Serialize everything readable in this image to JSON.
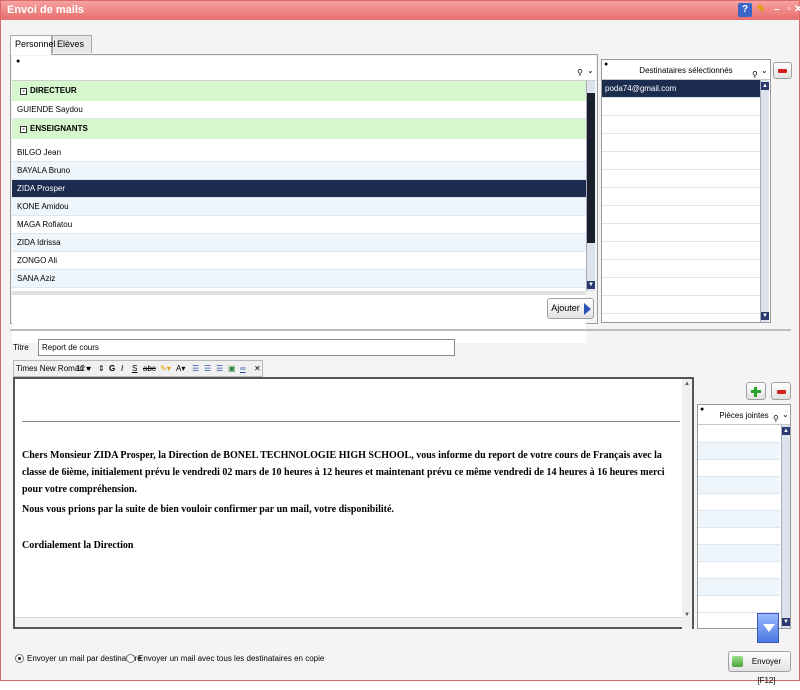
{
  "window": {
    "title": "Envoi de mails"
  },
  "tabs": [
    {
      "label": "Personnel",
      "active": true
    },
    {
      "label": "Elèves",
      "active": false
    }
  ],
  "staff": {
    "rows": [
      {
        "type": "group",
        "label": "DIRECTEUR"
      },
      {
        "type": "item",
        "label": "GUIENDE Saydou"
      },
      {
        "type": "group",
        "label": "ENSEIGNANTS"
      },
      {
        "type": "item",
        "label": "BILGO Jean"
      },
      {
        "type": "item",
        "label": "BAYALA Bruno"
      },
      {
        "type": "item",
        "label": "ZIDA Prosper",
        "selected": true
      },
      {
        "type": "item",
        "label": "KONE Amidou"
      },
      {
        "type": "item",
        "label": "MAGA Rofiatou"
      },
      {
        "type": "item",
        "label": "ZIDA Idrissa"
      },
      {
        "type": "item",
        "label": "ZONGO Ali"
      },
      {
        "type": "item",
        "label": "SANA Aziz"
      }
    ],
    "add_button": "Ajouter"
  },
  "recipients": {
    "header": "Destinataires sélectionnés",
    "items": [
      "poda74@gmail.com"
    ]
  },
  "title_field": {
    "label": "Titre",
    "value": "Report de cours"
  },
  "toolbar": {
    "font": "Times New Roman",
    "size": "12"
  },
  "message": {
    "paragraph1": "Chers Monsieur ZIDA Prosper, la Direction de BONEL TECHNOLOGIE HIGH SCHOOL, vous informe du report de votre cours de Français avec la classe de 6ième, initialement prévu le vendredi 02 mars de 10 heures à 12 heures et maintenant prévu ce même vendredi de 14 heures à 16 heures merci pour votre compréhension.",
    "paragraph2": "Nous vous prions par la suite de bien vouloir confirmer par un mail, votre disponibilité.",
    "paragraph3": "Cordialement la Direction"
  },
  "attachments": {
    "header": "Pièces jointes"
  },
  "send_options": {
    "option1": "Envoyer un mail par destinataire",
    "option2": "Envoyer un mail avec tous les destinataires en copie",
    "selected": 1
  },
  "send_button": "Envoyer [F12]",
  "colors": {
    "titlebar": "#e86e6e",
    "group_row": "#d6f7cd",
    "selected_row": "#1c2c4e"
  }
}
